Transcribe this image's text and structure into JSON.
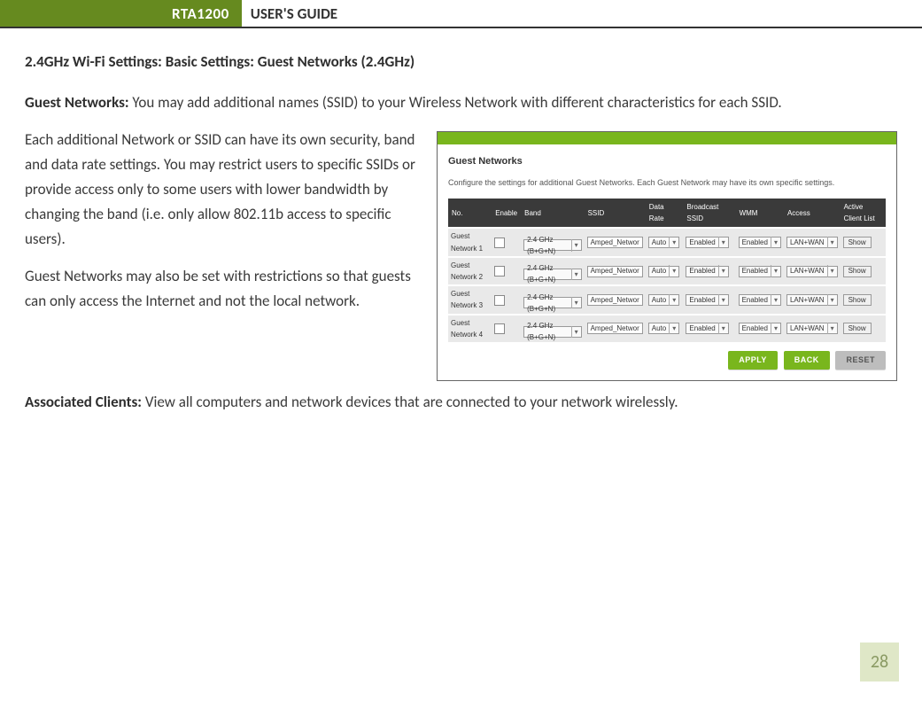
{
  "header": {
    "model": "RTA1200",
    "title": "USER'S GUIDE"
  },
  "section_heading": "2.4GHz Wi-Fi Settings: Basic Settings: Guest Networks (2.4GHz)",
  "para1_lead": "Guest Networks:",
  "para1_rest": "  You may add additional names (SSID) to your Wireless Network with different characteristics for each SSID.",
  "para2": "Each additional Network or SSID can have its own security, band and data rate settings.  You may restrict users to specific SSIDs or provide access only to some users with lower bandwidth by changing the band (i.e. only allow 802.11b access to specific users).",
  "para3": "Guest Networks may also be set with restrictions so that guests can only access the Internet and  not the local network.",
  "para4_lead": "Associated Clients:",
  "para4_rest": " View all computers and network devices that are connected to your network wirelessly.",
  "panel": {
    "title": "Guest Networks",
    "desc": "Configure the settings for additional Guest Networks. Each Guest Network may have its own specific settings.",
    "headers": {
      "no": "No.",
      "enable": "Enable",
      "band": "Band",
      "ssid": "SSID",
      "datarate": "Data Rate",
      "broadcast": "Broadcast SSID",
      "wmm": "WMM",
      "access": "Access",
      "client": "Active Client List"
    },
    "rows": [
      {
        "no": "Guest Network 1",
        "band": "2.4 GHz (B+G+N)",
        "ssid": "Amped_Networ",
        "rate": "Auto",
        "bcast": "Enabled",
        "wmm": "Enabled",
        "access": "LAN+WAN",
        "show": "Show"
      },
      {
        "no": "Guest Network 2",
        "band": "2.4 GHz (B+G+N)",
        "ssid": "Amped_Networ",
        "rate": "Auto",
        "bcast": "Enabled",
        "wmm": "Enabled",
        "access": "LAN+WAN",
        "show": "Show"
      },
      {
        "no": "Guest Network 3",
        "band": "2.4 GHz (B+G+N)",
        "ssid": "Amped_Networ",
        "rate": "Auto",
        "bcast": "Enabled",
        "wmm": "Enabled",
        "access": "LAN+WAN",
        "show": "Show"
      },
      {
        "no": "Guest Network 4",
        "band": "2.4 GHz (B+G+N)",
        "ssid": "Amped_Networ",
        "rate": "Auto",
        "bcast": "Enabled",
        "wmm": "Enabled",
        "access": "LAN+WAN",
        "show": "Show"
      }
    ],
    "buttons": {
      "apply": "APPLY",
      "back": "BACK",
      "reset": "RESET"
    }
  },
  "page_number": "28",
  "icons": {
    "caret": "▾"
  }
}
